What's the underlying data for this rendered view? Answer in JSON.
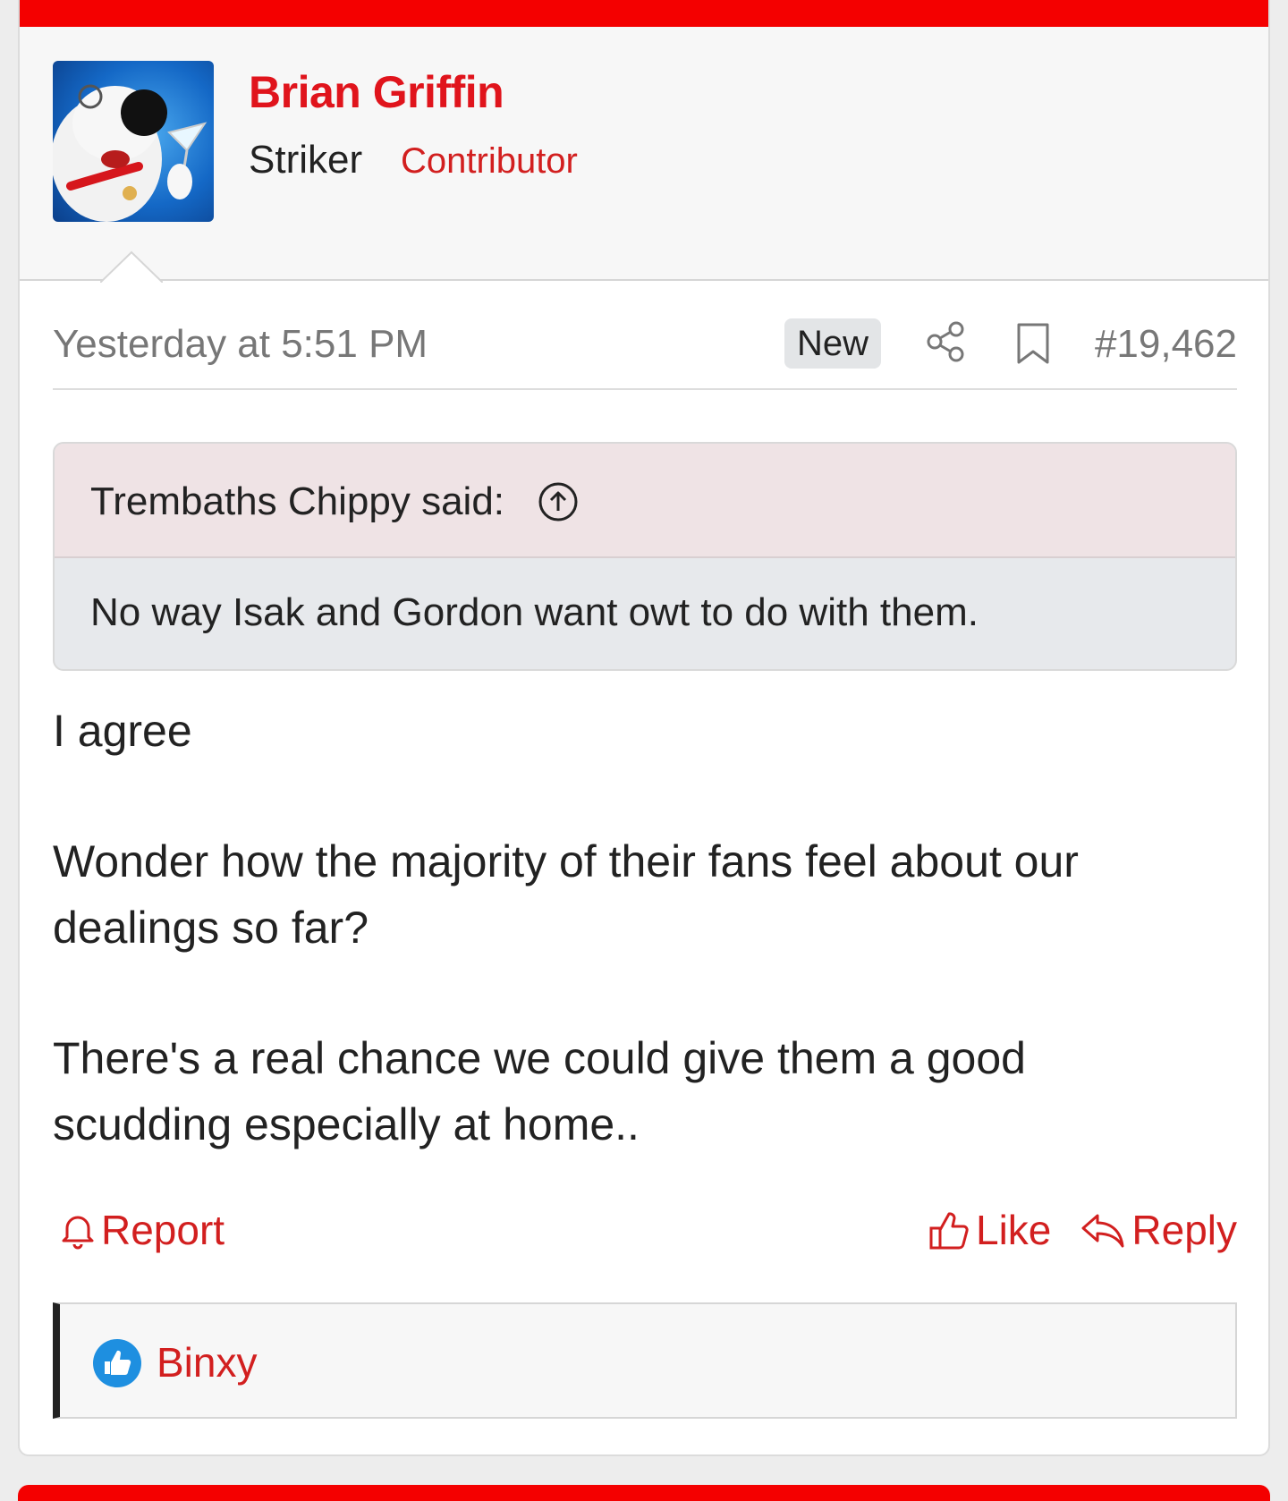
{
  "post": {
    "user": {
      "name": "Brian Griffin",
      "title": "Striker",
      "banner": "Contributor"
    },
    "meta": {
      "timestamp": "Yesterday at 5:51 PM",
      "badge": "New",
      "post_number": "#19,462"
    },
    "quote": {
      "author": "Trembaths Chippy said:",
      "text": "No way Isak and Gordon want owt to do with them."
    },
    "message": {
      "paragraphs": [
        "I agree",
        "Wonder how the majority of their fans feel about our dealings so far?",
        "There's a real chance we could give them a good scudding especially at home.."
      ]
    },
    "actions": {
      "report": "Report",
      "like": "Like",
      "reply": "Reply"
    },
    "reactions": {
      "likers": [
        "Binxy"
      ]
    },
    "colors": {
      "accent": "#f40000",
      "link": "#d21f1f",
      "quote_header": "#efe3e5",
      "quote_body": "#e7e9ec"
    }
  }
}
